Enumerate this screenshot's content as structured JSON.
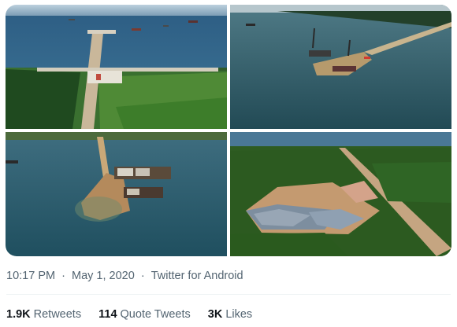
{
  "media": {
    "photos": [
      {
        "icon": "aerial-photo-pier-and-forest"
      },
      {
        "icon": "aerial-photo-pier-construction"
      },
      {
        "icon": "aerial-photo-reclamation-island"
      },
      {
        "icon": "aerial-photo-forest-clearing-site"
      }
    ]
  },
  "tweet_meta": {
    "time": "10:17 PM",
    "separator": "·",
    "date": "May 1, 2020",
    "source": "Twitter for Android"
  },
  "stats": {
    "retweets": {
      "count": "1.9K",
      "label": "Retweets"
    },
    "quote_tweets": {
      "count": "114",
      "label": "Quote Tweets"
    },
    "likes": {
      "count": "3K",
      "label": "Likes"
    }
  },
  "colors": {
    "text_primary": "#0f1419",
    "text_secondary": "#536471",
    "divider": "#eff3f4"
  }
}
